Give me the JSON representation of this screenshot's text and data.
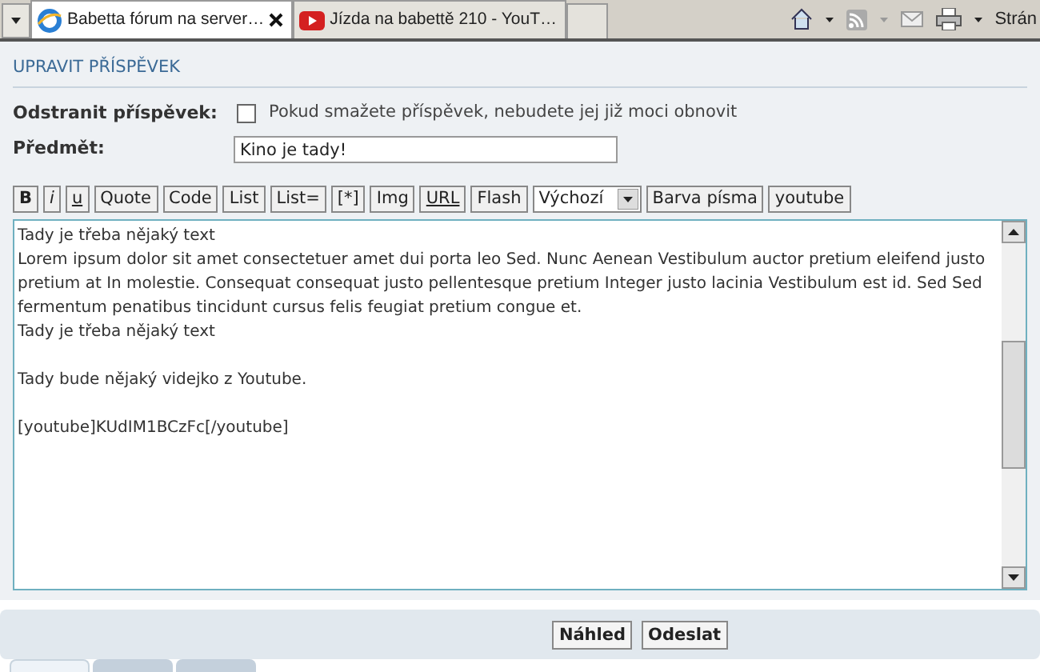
{
  "browser_tabs": [
    {
      "title": "Babetta fórum na server…",
      "selected": true
    },
    {
      "title": "Jízda na babettě 210 - YouT…",
      "selected": false
    }
  ],
  "browser_toolbar": {
    "page_menu": "Strán"
  },
  "section_title": "UPRAVIT PŘÍSPĚVEK",
  "delete": {
    "label": "Odstranit příspěvek:",
    "checked": false,
    "note": "Pokud smažete příspěvek, nebudete jej již moci obnovit"
  },
  "subject": {
    "label": "Předmět:",
    "value": "Kino je tady!"
  },
  "format_toolbar": [
    {
      "kind": "bold",
      "label": "B"
    },
    {
      "kind": "italic",
      "label": "i"
    },
    {
      "kind": "underline",
      "label": "u"
    },
    {
      "kind": "button",
      "label": "Quote"
    },
    {
      "kind": "button",
      "label": "Code"
    },
    {
      "kind": "button",
      "label": "List"
    },
    {
      "kind": "button",
      "label": "List="
    },
    {
      "kind": "button",
      "label": "[*]"
    },
    {
      "kind": "button",
      "label": "Img"
    },
    {
      "kind": "underline",
      "label": "URL"
    },
    {
      "kind": "button",
      "label": "Flash"
    },
    {
      "kind": "select",
      "label": "Výchozí"
    },
    {
      "kind": "button",
      "label": "Barva písma"
    },
    {
      "kind": "button",
      "label": "youtube"
    }
  ],
  "message_paragraphs": [
    {
      "lines": [
        "Tady je třeba nějaký text",
        "Lorem ipsum dolor sit amet consectetuer amet dui porta leo Sed. Nunc Aenean Vestibulum auctor pretium eleifend justo pretium at In molestie. Consequat consequat justo pellentesque pretium Integer justo lacinia Vestibulum est id. Sed Sed fermentum penatibus tincidunt cursus felis feugiat pretium congue et.",
        "Tady je třeba nějaký text"
      ]
    },
    {
      "lines": [
        "Tady bude nějaký videjko z Youtube."
      ]
    },
    {
      "lines": [
        "[youtube]KUdIM1BCzFc[/youtube]"
      ]
    }
  ],
  "actions": [
    "Náhled",
    "Odeslat"
  ],
  "bottom_tabs": [
    {
      "selected": true
    },
    {
      "selected": false
    },
    {
      "selected": false
    }
  ]
}
